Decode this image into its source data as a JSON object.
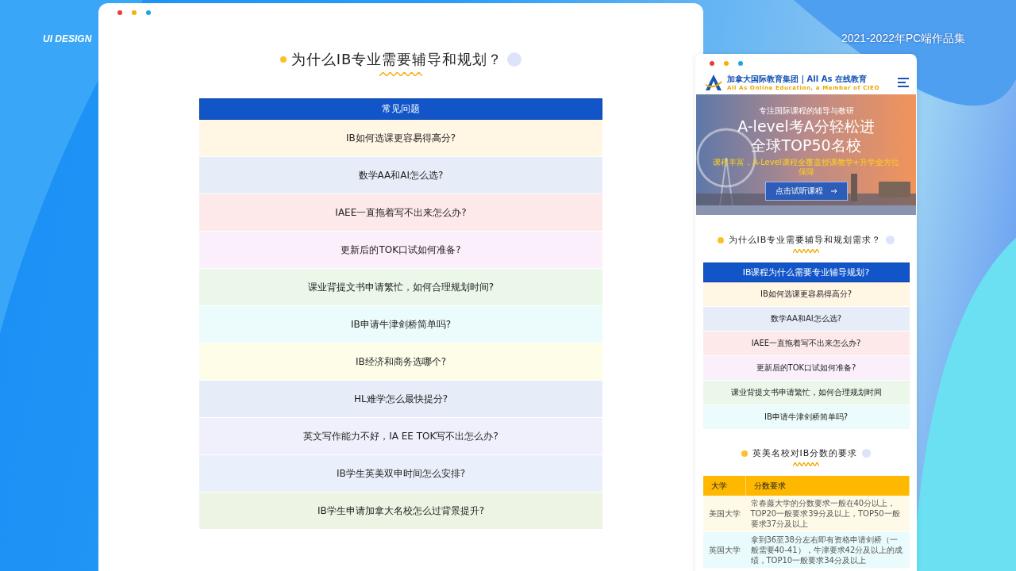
{
  "side_labels": {
    "left": "UI DESIGN",
    "right": "2021-2022年PC端作品集"
  },
  "desktop": {
    "title": "为什么IB专业需要辅导和规划？",
    "faq_header": "常见问题",
    "faq": [
      {
        "text": "IB如何选课更容易得高分?",
        "color": "#fff6e3"
      },
      {
        "text": "数学AA和AI怎么选?",
        "color": "#e6edf8"
      },
      {
        "text": "IAEE一直拖着写不出来怎么办?",
        "color": "#fde9e9"
      },
      {
        "text": "更新后的TOK口试如何准备?",
        "color": "#fbeffc"
      },
      {
        "text": "课业背提文书申请繁忙，如何合理规划时间?",
        "color": "#eaf7e9"
      },
      {
        "text": "IB申请牛津剑桥简单吗?",
        "color": "#ecfbfb"
      },
      {
        "text": "IB经济和商务选哪个?",
        "color": "#fdfde8"
      },
      {
        "text": "HL难学怎么最快提分?",
        "color": "#e6edf8"
      },
      {
        "text": "英文写作能力不好，IA   EE   TOK写不出怎么办?",
        "color": "#eff0fb"
      },
      {
        "text": "IB学生英美双申时间怎么安排?",
        "color": "#eaf0fb"
      },
      {
        "text": "IB学生申请加拿大名校怎么过背景提升?",
        "color": "#eef4e3"
      }
    ]
  },
  "mobile": {
    "brand": "加拿大国际教育集团 | All As 在线教育",
    "brand_sub": "All As Online Education, a Member of CIEO",
    "banner": {
      "kicker": "专注国际课程的辅导与教研",
      "headline": [
        "A-level考A分轻松进",
        "全球TOP50名校"
      ],
      "tagline": "课程丰富，A-Level课程全覆盖授课教学+升学全方位保障",
      "button": "点击试听课程"
    },
    "section1": {
      "title": "为什么IB专业需要辅导和规划需求？",
      "table_header": "IB课程为什么需要专业辅导规划?",
      "faq": [
        {
          "text": "IB如何选课更容易得高分?",
          "color": "#fff6e3"
        },
        {
          "text": "数学AA和AI怎么选?",
          "color": "#e6edf8"
        },
        {
          "text": "IAEE一直拖着写不出来怎么办?",
          "color": "#fde9e9"
        },
        {
          "text": "更新后的TOK口试如何准备?",
          "color": "#fbeffc"
        },
        {
          "text": "课业背提文书申请繁忙，如何合理规划时间",
          "color": "#eaf7e9"
        },
        {
          "text": "IB申请牛津剑桥简单吗?",
          "color": "#ecfbfb"
        }
      ]
    },
    "section2": {
      "title": "英美名校对IB分数的要求",
      "columns": [
        "大学",
        "分数要求"
      ],
      "rows": [
        {
          "cells": [
            "美国大学",
            "常春藤大学的分数要求一般在40分以上，TOP20一般要求39分及以上，TOP50一般要求37分及以上"
          ],
          "color": "#fffae8"
        },
        {
          "cells": [
            "英国大学",
            "拿到36至38分左右即有资格申请剑桥（一般需要40-41），牛津要求42分及以上的成绩，TOP10一般要求34分及以上"
          ],
          "color": "#e9fbfc"
        }
      ]
    }
  }
}
